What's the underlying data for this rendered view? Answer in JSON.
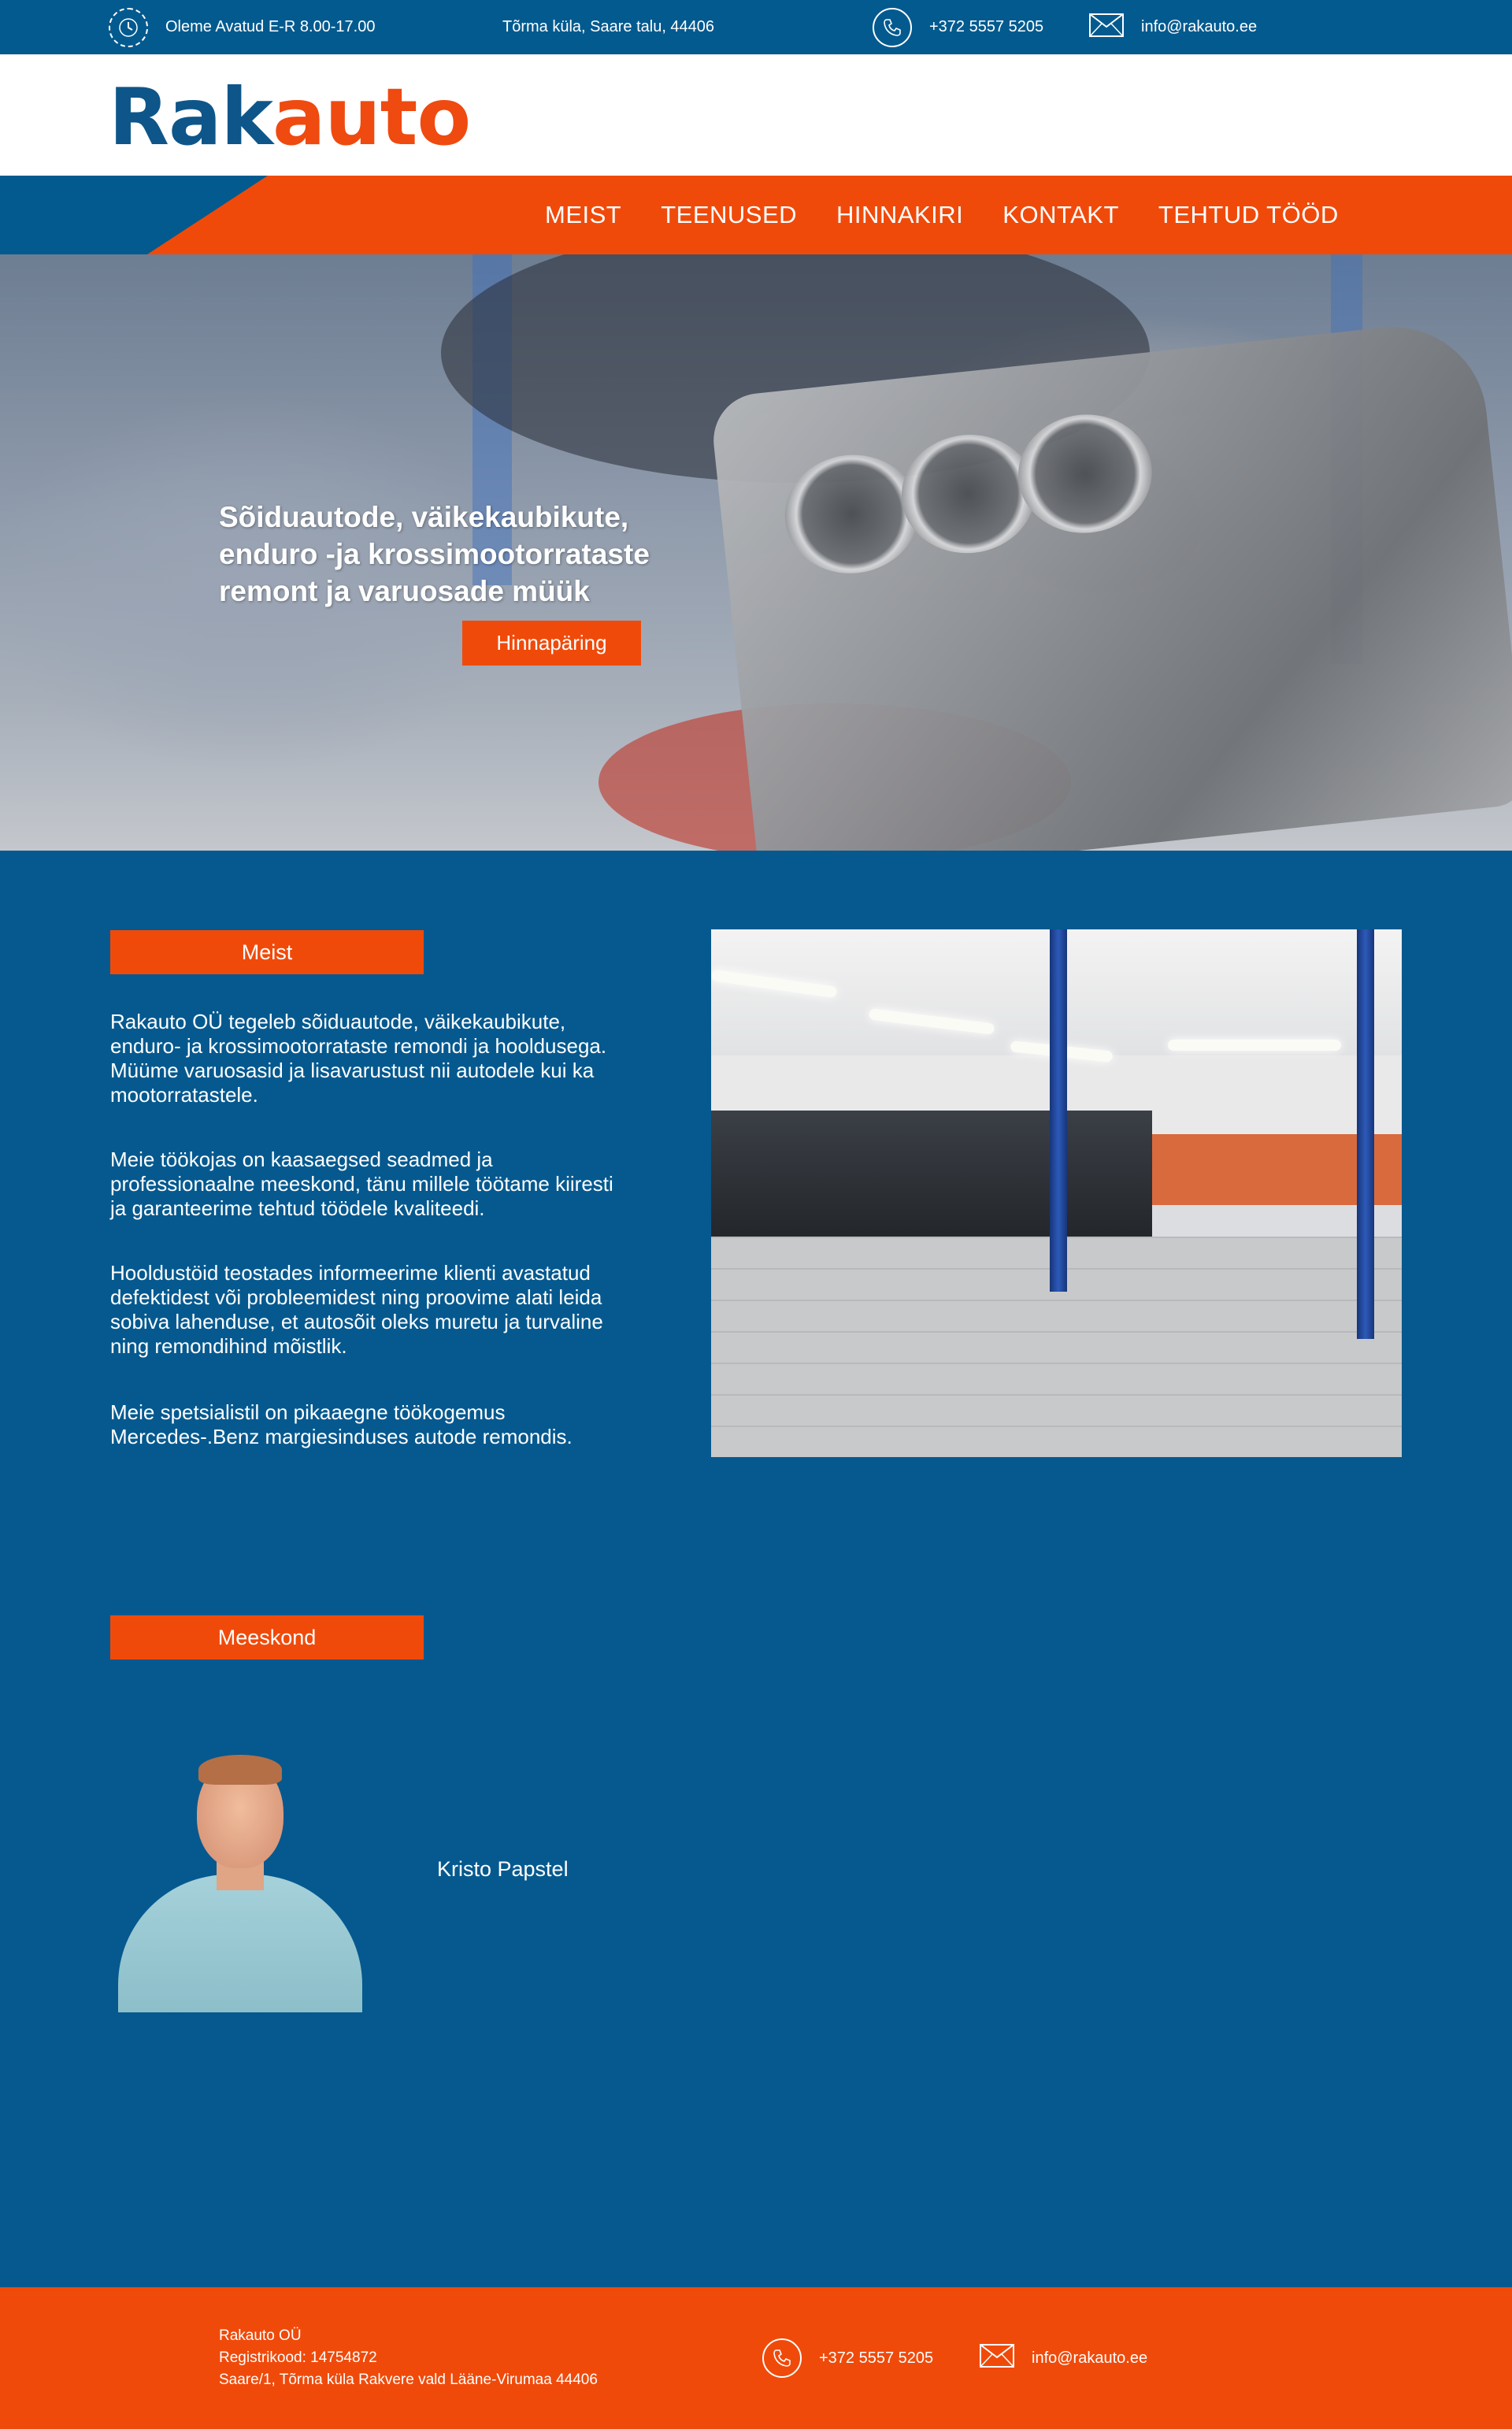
{
  "topbar": {
    "hours": "Oleme Avatud E-R 8.00-17.00",
    "address": "Tõrma küla, Saare talu, 44406",
    "phone": "+372 5557 5205",
    "email": "info@rakauto.ee"
  },
  "logo": {
    "part1": "Rak",
    "part2": "auto"
  },
  "colors": {
    "primary_blue": "#05598f",
    "accent_orange": "#f04a0a"
  },
  "nav": {
    "items": [
      {
        "label": "MEIST"
      },
      {
        "label": "TEENUSED"
      },
      {
        "label": "HINNAKIRI"
      },
      {
        "label": "KONTAKT"
      },
      {
        "label": "TEHTUD TÖÖD"
      }
    ]
  },
  "hero": {
    "title": "Sõiduautode, väikekaubikute, enduro -ja krossimootorrataste remont ja varuosade müük",
    "cta_label": "Hinnapäring"
  },
  "about": {
    "heading": "Meist",
    "paragraphs": [
      "Rakauto OÜ tegeleb sõiduautode, väikekaubikute, enduro- ja krossimootorrataste remondi ja hooldusega. Müüme varuosasid ja lisavarustust nii autodele kui ka mootorratastele.",
      "Meie töökojas on kaasaegsed seadmed ja professionaalne meeskond, tänu millele töötame kiiresti ja garanteerime tehtud töödele kvaliteedi.",
      "Hooldustöid teostades informeerime klienti avastatud defektidest või probleemidest ning proovime alati leida sobiva lahenduse, et autosõit oleks muretu ja turvaline ning remondihind mõistlik.",
      "Meie spetsialistil on pikaaegne töökogemus Mercedes-.Benz margiesinduses autode remondis."
    ]
  },
  "team": {
    "heading": "Meeskond",
    "members": [
      {
        "name": "Kristo Papstel"
      }
    ]
  },
  "footer": {
    "company": "Rakauto OÜ",
    "regcode": "Registrikood: 14754872",
    "address": "Saare/1, Tõrma küla Rakvere vald Lääne-Virumaa 44406",
    "phone": "+372 5557 5205",
    "email": "info@rakauto.ee"
  }
}
